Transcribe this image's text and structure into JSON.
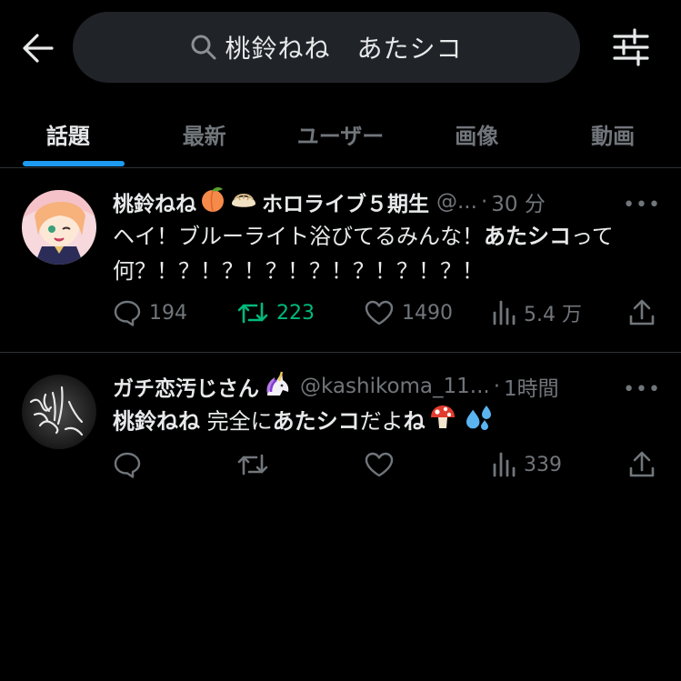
{
  "search": {
    "query": "桃鈴ねね　あたシコ"
  },
  "tabs": [
    {
      "label": "話題",
      "active": true
    },
    {
      "label": "最新",
      "active": false
    },
    {
      "label": "ユーザー",
      "active": false
    },
    {
      "label": "画像",
      "active": false
    },
    {
      "label": "動画",
      "active": false
    }
  ],
  "colors": {
    "accent": "#1d9bf0",
    "retweet": "#00ba7c",
    "muted": "#71767b",
    "search_bg": "#202327"
  },
  "tweets": [
    {
      "display_name": "桃鈴ねね",
      "name_suffix": "ホロライブ５期生",
      "handle": "@...",
      "time": "30 分",
      "more": "•••",
      "text_1": "ヘイ！ブルーライト浴びてるみんな！",
      "text_bold": "あたシコ",
      "text_2": "って何？！？！？！？！？！？！？！？！",
      "replies": "194",
      "retweets": "223",
      "likes": "1490",
      "views": "5.4 万",
      "emojis": [
        "peach-emoji",
        "dumpling-emoji"
      ]
    },
    {
      "display_name": "ガチ恋汚じさん",
      "handle": "@kashikoma_11...",
      "time": "1時間",
      "more": "•••",
      "text_bold_1": "桃鈴ねね",
      "text_mid": " 完全に",
      "text_bold_2": "あたシコ",
      "text_mid_2": "だよ",
      "text_bold_3": "ね",
      "views": "339",
      "emojis": [
        "unicorn-emoji",
        "mushroom-emoji",
        "sweat-droplets-emoji"
      ]
    }
  ]
}
